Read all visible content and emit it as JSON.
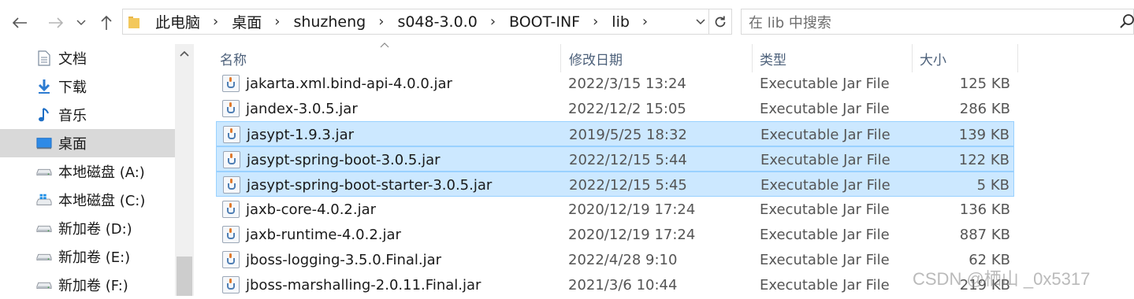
{
  "breadcrumbs": [
    "此电脑",
    "桌面",
    "shuzheng",
    "s048-3.0.0",
    "BOOT-INF",
    "lib"
  ],
  "search": {
    "placeholder": "在 lib 中搜索"
  },
  "sidebar": {
    "items": [
      {
        "label": "文档",
        "icon": "document-icon"
      },
      {
        "label": "下载",
        "icon": "download-icon"
      },
      {
        "label": "音乐",
        "icon": "music-icon"
      },
      {
        "label": "桌面",
        "icon": "desktop-icon",
        "selected": true
      },
      {
        "label": "本地磁盘 (A:)",
        "icon": "drive-icon"
      },
      {
        "label": "本地磁盘 (C:)",
        "icon": "windows-drive-icon"
      },
      {
        "label": "新加卷 (D:)",
        "icon": "drive-icon"
      },
      {
        "label": "新加卷 (E:)",
        "icon": "drive-icon"
      },
      {
        "label": "新加卷 (F:)",
        "icon": "drive-icon"
      }
    ]
  },
  "columns": {
    "name": "名称",
    "date": "修改日期",
    "type": "类型",
    "size": "大小"
  },
  "files": [
    {
      "name": "jakarta.xml.bind-api-4.0.0.jar",
      "date": "2022/3/15 13:24",
      "type": "Executable Jar File",
      "size": "125 KB",
      "selected": false
    },
    {
      "name": "jandex-3.0.5.jar",
      "date": "2022/12/2 15:05",
      "type": "Executable Jar File",
      "size": "286 KB",
      "selected": false
    },
    {
      "name": "jasypt-1.9.3.jar",
      "date": "2019/5/25 18:32",
      "type": "Executable Jar File",
      "size": "139 KB",
      "selected": true
    },
    {
      "name": "jasypt-spring-boot-3.0.5.jar",
      "date": "2022/12/15 5:44",
      "type": "Executable Jar File",
      "size": "122 KB",
      "selected": true
    },
    {
      "name": "jasypt-spring-boot-starter-3.0.5.jar",
      "date": "2022/12/15 5:45",
      "type": "Executable Jar File",
      "size": "5 KB",
      "selected": true
    },
    {
      "name": "jaxb-core-4.0.2.jar",
      "date": "2020/12/19 17:24",
      "type": "Executable Jar File",
      "size": "136 KB",
      "selected": false
    },
    {
      "name": "jaxb-runtime-4.0.2.jar",
      "date": "2020/12/19 17:24",
      "type": "Executable Jar File",
      "size": "887 KB",
      "selected": false
    },
    {
      "name": "jboss-logging-3.5.0.Final.jar",
      "date": "2022/4/28 9:10",
      "type": "Executable Jar File",
      "size": "62 KB",
      "selected": false
    },
    {
      "name": "jboss-marshalling-2.0.11.Final.jar",
      "date": "2021/3/6 10:44",
      "type": "Executable Jar File",
      "size": "219 KB",
      "selected": false
    }
  ],
  "watermark": "CSDN @栖山 _0x5317",
  "colors": {
    "selection": "#cce8ff",
    "selection_border": "#99d1ff",
    "sidebar_selected": "#d9d9d9",
    "header_text": "#4c607a"
  }
}
